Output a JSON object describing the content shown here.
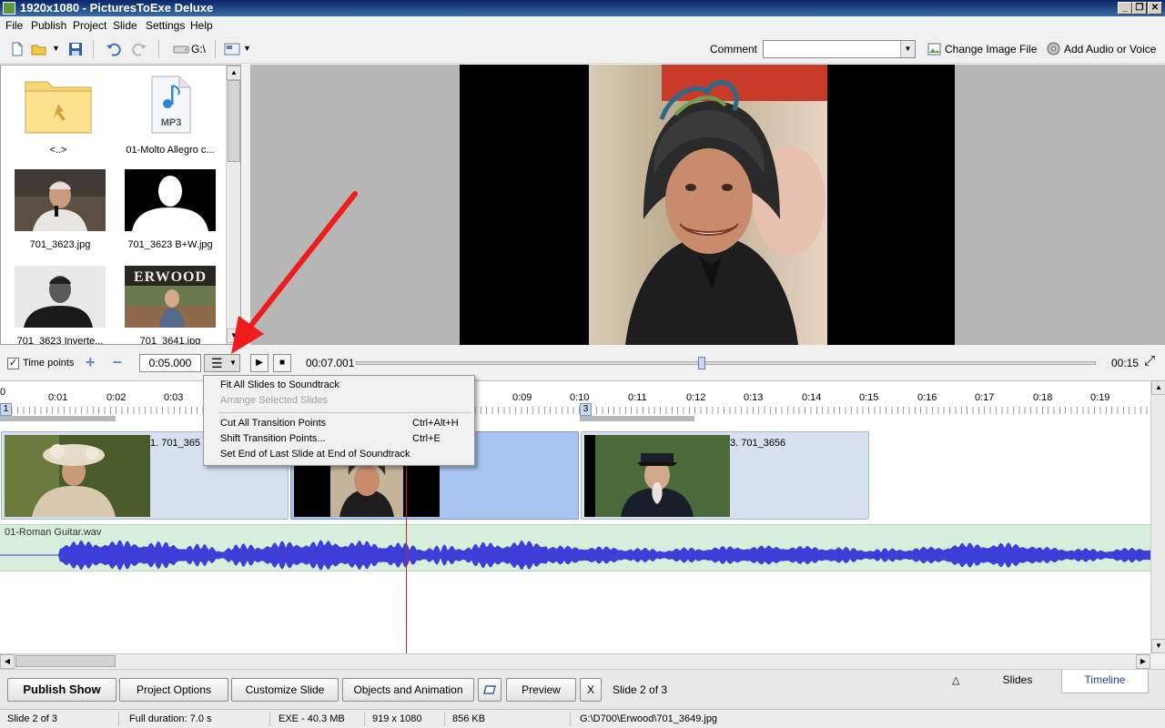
{
  "window": {
    "title": "1920x1080 - PicturesToExe Deluxe",
    "controls": [
      "_",
      "❐",
      "✕"
    ]
  },
  "menu": [
    "File",
    "Publish",
    "Project",
    "Slide",
    "Settings",
    "Help"
  ],
  "toolbar": {
    "drive_label": "G:\\",
    "comment_label": "Comment",
    "comment_value": "",
    "change_image_label": "Change Image File",
    "add_audio_label": "Add Audio or Voice"
  },
  "files": [
    {
      "name": "<..>",
      "icon": "folder-icon"
    },
    {
      "name": "01-Molto Allegro c...",
      "icon": "mp3-file-icon",
      "badge": "MP3"
    },
    {
      "name": "701_3623.jpg",
      "icon": "photo-thumbnail"
    },
    {
      "name": "701_3623 B+W.jpg",
      "icon": "photo-thumbnail"
    },
    {
      "name": "701_3623 Inverte...",
      "icon": "photo-thumbnail"
    },
    {
      "name": "701_3641.jpg",
      "icon": "photo-thumbnail",
      "sign": "ERWOOD"
    }
  ],
  "timeline_controls": {
    "time_points_label": "Time points",
    "time_points_checked": true,
    "duration_value": "0:05.000",
    "current_time": "00:07.001",
    "total_time": "00:15",
    "playhead_fraction": 0.466
  },
  "context_menu": {
    "items": [
      {
        "label": "Fit All Slides to Soundtrack",
        "shortcut": "",
        "disabled": false
      },
      {
        "label": "Arrange Selected Slides",
        "shortcut": "",
        "disabled": true
      },
      {
        "label": "Cut All Transition Points",
        "shortcut": "Ctrl+Alt+H",
        "disabled": false
      },
      {
        "label": "Shift Transition Points...",
        "shortcut": "Ctrl+E",
        "disabled": false
      },
      {
        "label": "Set End of Last Slide at End of Soundtrack",
        "shortcut": "",
        "disabled": false
      }
    ]
  },
  "ruler": {
    "ticks": [
      "0",
      "0:01",
      "0:02",
      "0:03",
      "0:09",
      "0:10",
      "0:11",
      "0:12",
      "0:13",
      "0:14",
      "0:15",
      "0:16",
      "0:17",
      "0:18",
      "0:19"
    ],
    "markers": [
      "1",
      "3"
    ]
  },
  "slides": [
    {
      "title": "1. 701_365",
      "selected": false
    },
    {
      "title": "3649",
      "selected": true
    },
    {
      "title": "3. 701_3656",
      "selected": false
    }
  ],
  "audio": {
    "file": "01-Roman Guitar.wav",
    "color": "#3b3fd8"
  },
  "buttons": {
    "publish": "Publish Show",
    "project_options": "Project Options",
    "customize_slide": "Customize Slide",
    "objects": "Objects and Animation",
    "preview": "Preview",
    "close": "X",
    "slide_counter": "Slide 2 of 3",
    "view_slides": "Slides",
    "view_timeline": "Timeline"
  },
  "status": {
    "slide": "Slide 2 of 3",
    "duration": "Full duration: 7.0 s",
    "exe": "EXE - 40.3 MB",
    "dimensions": "919 x 1080",
    "size": "856 KB",
    "path": "G:\\D700\\Erwood\\701_3649.jpg"
  },
  "annotation": {
    "color": "#ee1c1c"
  }
}
